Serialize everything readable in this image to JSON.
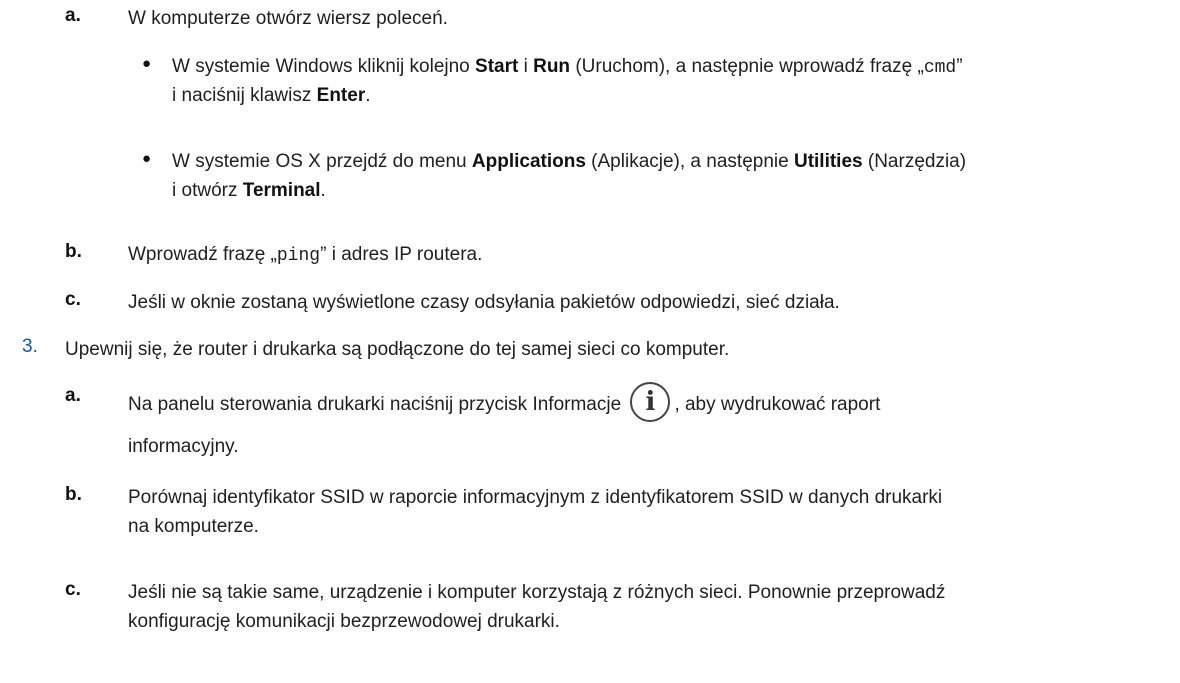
{
  "items": {
    "a1": {
      "marker": "a.",
      "text": "W komputerze otwórz wiersz poleceń."
    },
    "bullet1": {
      "marker": "●",
      "l1_p1": "W systemie Windows kliknij kolejno ",
      "l1_b1": "Start",
      "l1_p2": " i ",
      "l1_b2": "Run",
      "l1_p3": " (Uruchom), a następnie wprowadź frazę ",
      "l1_q1": "„",
      "l1_code": "cmd",
      "l1_q2": "”",
      "l2_p1": "i naciśnij klawisz ",
      "l2_b1": "Enter",
      "l2_p2": "."
    },
    "bullet2": {
      "marker": "●",
      "l1_p1": "W systemie OS X przejdź do menu ",
      "l1_b1": "Applications",
      "l1_p2": " (Aplikacje), a następnie ",
      "l1_b2": "Utilities",
      "l1_p3": " (Narzędzia)",
      "l2_p1": "i otwórz ",
      "l2_b1": "Terminal",
      "l2_p2": "."
    },
    "b1": {
      "marker": "b.",
      "p1": "Wprowadź frazę ",
      "q1": "„",
      "code": "ping",
      "q2": "”",
      "p2": " i adres IP routera."
    },
    "c1": {
      "marker": "c.",
      "text": "Jeśli w oknie zostaną wyświetlone czasy odsyłania pakietów odpowiedzi, sieć działa."
    },
    "step3": {
      "marker": "3.",
      "text": "Upewnij się, że router i drukarka są podłączone do tej samej sieci co komputer."
    },
    "a2": {
      "marker": "a.",
      "p1": "Na panelu sterowania drukarki naciśnij przycisk Informacje",
      "icon_glyph": "i",
      "p2": ", aby wydrukować raport",
      "l2": "informacyjny."
    },
    "b2": {
      "marker": "b.",
      "l1": "Porównaj identyfikator SSID w raporcie informacyjnym z identyfikatorem SSID w danych drukarki",
      "l2": "na komputerze."
    },
    "c2": {
      "marker": "c.",
      "l1": "Jeśli nie są takie same, urządzenie i komputer korzystają z różnych sieci. Ponownie przeprowadź",
      "l2": "konfigurację komunikacji bezprzewodowej drukarki."
    }
  },
  "colors": {
    "text": "#1f1f1f",
    "step_number": "#0a5cab"
  },
  "icons": [
    "information-icon"
  ]
}
